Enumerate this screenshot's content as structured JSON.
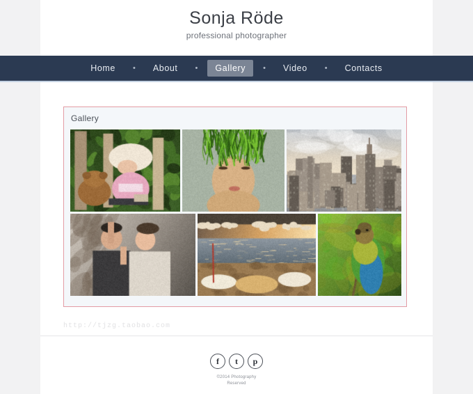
{
  "site": {
    "title": "Sonja Röde",
    "tagline": "professional photographer"
  },
  "nav": {
    "separator": "•",
    "items": [
      {
        "label": "Home",
        "active": false
      },
      {
        "label": "About",
        "active": false
      },
      {
        "label": "Gallery",
        "active": true
      },
      {
        "label": "Video",
        "active": false
      },
      {
        "label": "Contacts",
        "active": false
      }
    ]
  },
  "gallery": {
    "panel_title": "Gallery",
    "border_color": "#e39ba4",
    "panel_background": "#f4f7fa",
    "rows": [
      {
        "items": [
          {
            "name": "girl-with-teddy-bear",
            "alt": "Girl in sun hat reading with teddy bear on bench"
          },
          {
            "name": "woman-with-grass-hair",
            "alt": "Portrait of woman with green grass hair"
          },
          {
            "name": "city-skyline",
            "alt": "New York city skyline at dusk"
          }
        ]
      },
      {
        "items": [
          {
            "name": "couple-portrait",
            "alt": "Couple embracing, man with hand on face"
          },
          {
            "name": "boats-at-sunset",
            "alt": "Wooden boats on shore at golden sunset"
          },
          {
            "name": "green-parrot",
            "alt": "Green parrot perched on branch"
          }
        ]
      }
    ]
  },
  "watermark": {
    "text": "http://tjzg.taobao.com"
  },
  "footer": {
    "social": [
      {
        "name": "facebook",
        "glyph": "f"
      },
      {
        "name": "tumblr",
        "glyph": "t"
      },
      {
        "name": "pinterest",
        "glyph": "p"
      }
    ],
    "copyright_line1": "©2014  Photography",
    "copyright_line2": "Reserved"
  },
  "theme": {
    "nav_background": "#2b3a52",
    "nav_active_background": "#7b8595",
    "page_background": "#f2f2f3",
    "sheet_background": "#ffffff"
  }
}
